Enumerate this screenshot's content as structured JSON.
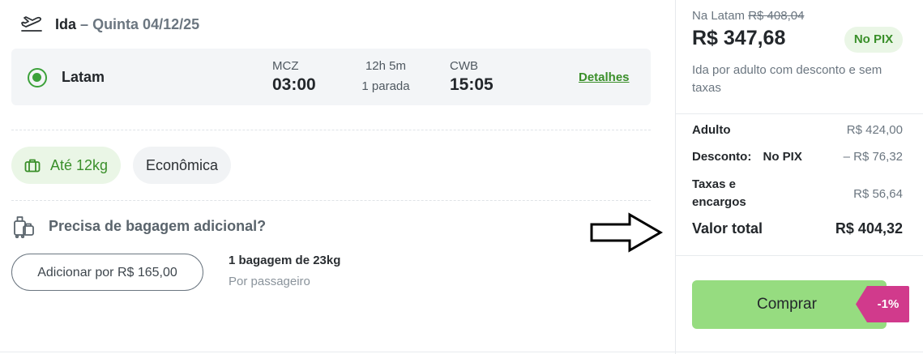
{
  "flight": {
    "direction": "Ida",
    "separator": "–",
    "date": "Quinta 04/12/25",
    "airline": "Latam",
    "origin_code": "MCZ",
    "departure_time": "03:00",
    "duration": "12h 5m",
    "stops": "1 parada",
    "destination_code": "CWB",
    "arrival_time": "15:05",
    "details_link": "Detalhes"
  },
  "fare": {
    "baggage_chip": "Até 12kg",
    "class_chip": "Econômica"
  },
  "extra_baggage": {
    "question": "Precisa de bagagem adicional?",
    "add_button": "Adicionar por R$ 165,00",
    "bag_desc": "1 bagagem de 23kg",
    "bag_sub": "Por passageiro"
  },
  "summary": {
    "na_latam_label": "Na Latam",
    "na_latam_old_price": "R$ 408,04",
    "price": "R$ 347,68",
    "pix_badge": "No PIX",
    "note": "Ida por adulto com desconto e sem taxas",
    "adult_label": "Adulto",
    "adult_value": "R$ 424,00",
    "discount_label": "Desconto:",
    "discount_method": "No PIX",
    "discount_value": "– R$ 76,32",
    "taxes_label": "Taxas e encargos",
    "taxes_value": "R$ 56,64",
    "total_label": "Valor total",
    "total_value": "R$ 404,32",
    "buy_button": "Comprar",
    "discount_tag": "-1%"
  },
  "colors": {
    "accent_green": "#3a8f2a",
    "buy_green": "#96dc80",
    "discount_pink": "#d13a8c"
  }
}
